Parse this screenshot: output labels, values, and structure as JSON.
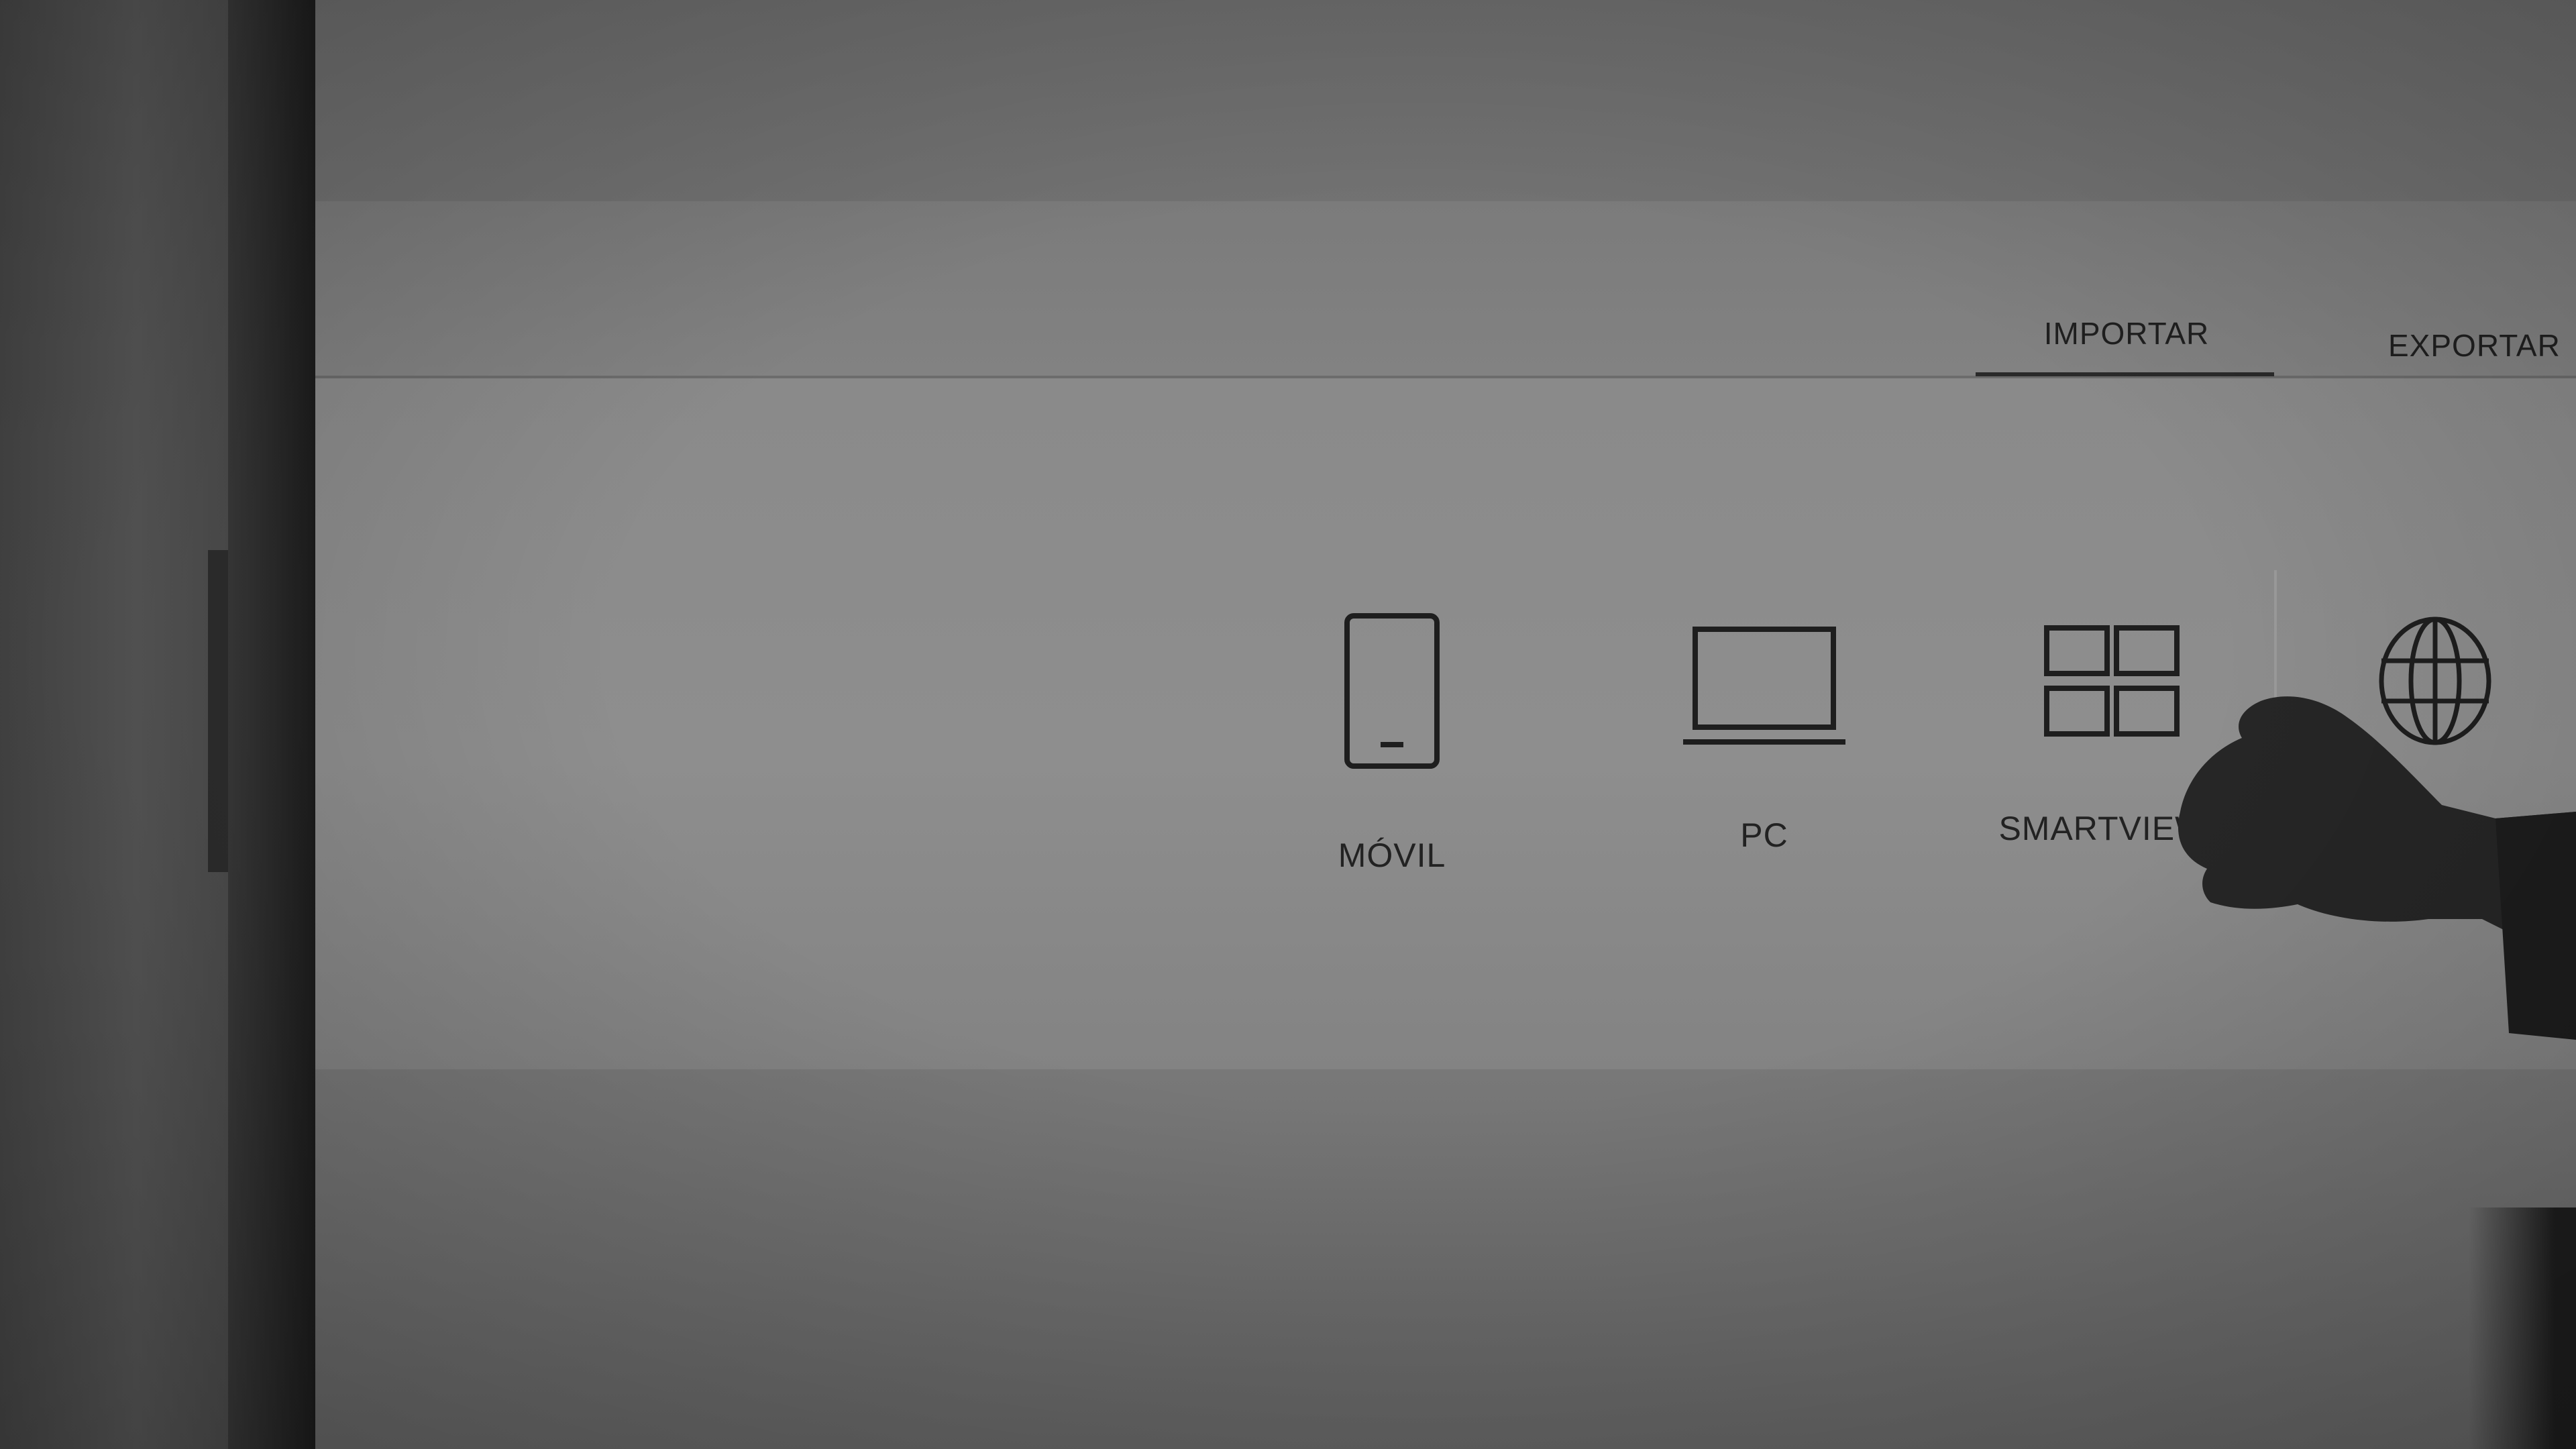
{
  "tabs": {
    "import_label": "IMPORTAR",
    "export_label": "EXPORTAR",
    "active": "IMPORTAR"
  },
  "sources": [
    {
      "label": "MÓVIL",
      "icon": "smartphone-icon"
    },
    {
      "label": "PC",
      "icon": "laptop-icon"
    },
    {
      "label": "SMARTVIEW+",
      "icon": "grid-icon"
    },
    {
      "label": "",
      "icon": "globe-icon"
    }
  ],
  "colors": {
    "text": "#222222",
    "active_tab_underline": "#2a2a2a"
  }
}
